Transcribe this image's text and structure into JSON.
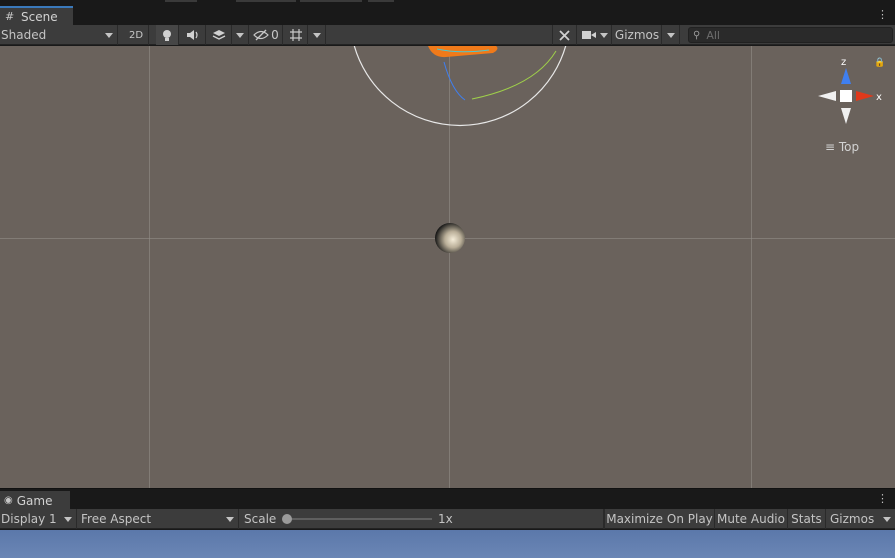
{
  "scene_tab": {
    "label": "Scene",
    "icon": "grid-icon"
  },
  "scene_toolbar": {
    "shading_mode": "Shaded",
    "mode_2d": "2D",
    "hidden_count": "0",
    "gizmos_label": "Gizmos",
    "search_placeholder": "All"
  },
  "orientation_gizmo": {
    "axis_z": "z",
    "axis_x": "x",
    "view_label": "Top",
    "colors": {
      "x": "#e0391b",
      "z": "#3f7ff0",
      "center": "#ffffff"
    }
  },
  "game_tab": {
    "label": "Game",
    "icon": "gamepad-icon"
  },
  "game_toolbar": {
    "display": "Display 1",
    "aspect": "Free Aspect",
    "scale_label": "Scale",
    "scale_value": "1x",
    "scale_slider_fraction": 0.0,
    "maximize_on_play": "Maximize On Play",
    "mute_audio": "Mute Audio",
    "stats": "Stats",
    "gizmos": "Gizmos"
  },
  "colors": {
    "accent": "#3a79bb",
    "scene_background": "#6a625c",
    "panel": "#3c3c3c",
    "sky": "#5b78aa"
  }
}
